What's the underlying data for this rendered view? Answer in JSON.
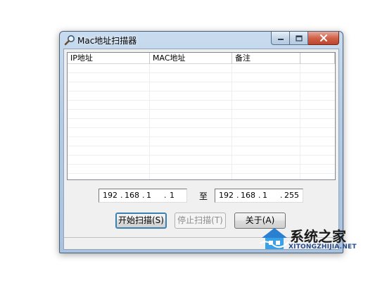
{
  "window": {
    "title": "Mac地址扫描器",
    "title_icon": "magnifier-icon",
    "caption_icons": [
      "minimize-icon",
      "maximize-icon",
      "close-icon"
    ]
  },
  "list": {
    "columns": [
      "IP地址",
      "MAC地址",
      "备注",
      ""
    ],
    "rows": []
  },
  "range": {
    "start": [
      "192",
      "168",
      "1",
      "1"
    ],
    "to_label": "至",
    "end": [
      "192",
      "168",
      "1",
      "255"
    ]
  },
  "buttons": {
    "start_scan": "开始扫描(S)",
    "stop_scan": "停止扫描(T)",
    "about": "关于(A)"
  },
  "watermark": {
    "text": "系统之家",
    "url": "XITONGZHIJIA.NET"
  }
}
